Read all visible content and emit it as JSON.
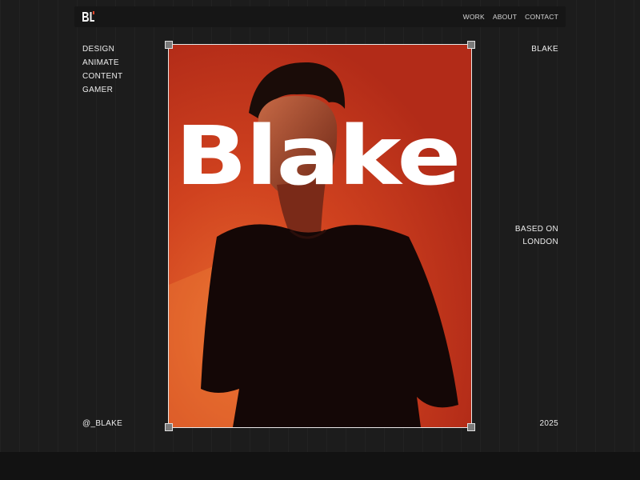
{
  "header": {
    "logo_text": "BL",
    "nav": [
      "WORK",
      "ABOUT",
      "CONTACT"
    ]
  },
  "left_column": {
    "roles": [
      "DESIGN",
      "ANIMATE",
      "CONTENT",
      "GAMER"
    ]
  },
  "right_column": {
    "name": "BLAKE",
    "location_line1": "BASED ON",
    "location_line2": "LONDON"
  },
  "hero": {
    "overlay_word": "Blake",
    "background_color": "#c8341c"
  },
  "footer": {
    "handle": "@_BLAKE",
    "year": "2025"
  },
  "colors": {
    "page_bg": "#1c1c1c",
    "accent": "#c8341c",
    "text": "#ececec"
  }
}
